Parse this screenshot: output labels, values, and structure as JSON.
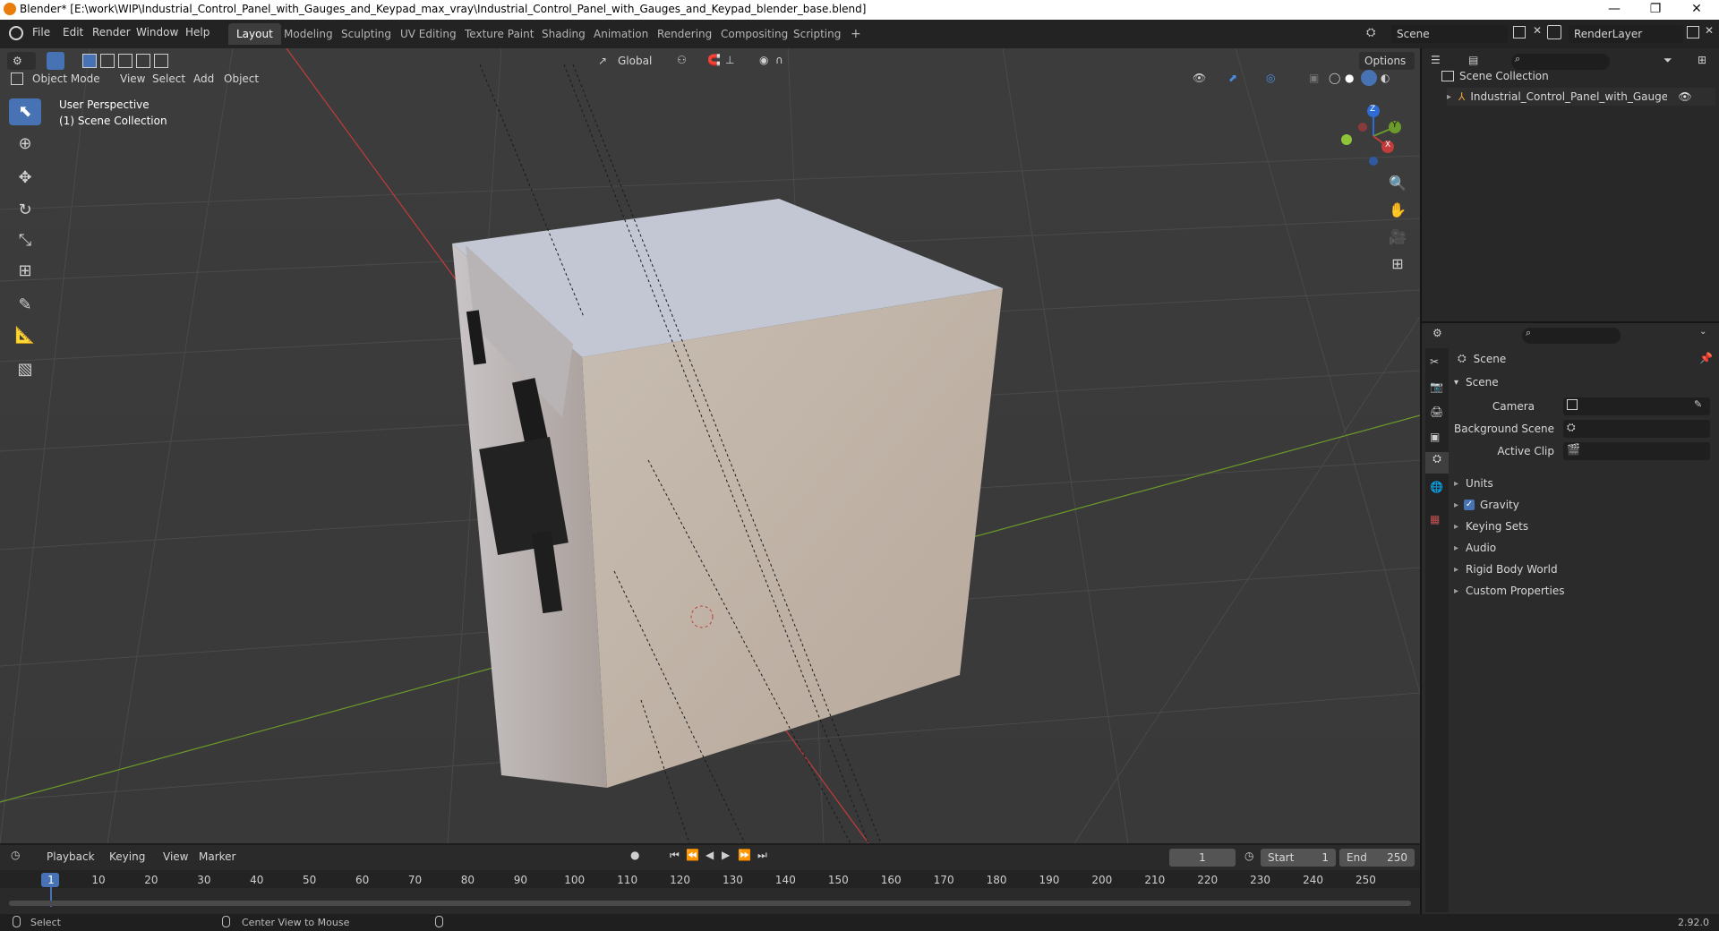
{
  "window": {
    "title": "Blender* [E:\\work\\WIP\\Industrial_Control_Panel_with_Gauges_and_Keypad_max_vray\\Industrial_Control_Panel_with_Gauges_and_Keypad_blender_base.blend]",
    "minimize": "—",
    "restore": "❐",
    "close": "✕"
  },
  "menubar": {
    "items": [
      "File",
      "Edit",
      "Render",
      "Window",
      "Help"
    ],
    "workspaces": [
      "Layout",
      "Modeling",
      "Sculpting",
      "UV Editing",
      "Texture Paint",
      "Shading",
      "Animation",
      "Rendering",
      "Compositing",
      "Scripting"
    ],
    "add_tab": "+",
    "scene": "Scene",
    "render_layer": "RenderLayer"
  },
  "viewport": {
    "mode": "Object Mode",
    "menu": [
      "View",
      "Select",
      "Add",
      "Object"
    ],
    "orientation": "Global",
    "options": "Options",
    "perspective_label": "User Perspective",
    "collection_label": "(1) Scene Collection",
    "gizmo": {
      "z": "Z",
      "y": "Y",
      "x": "X"
    }
  },
  "outliner": {
    "root": "Scene Collection",
    "items": [
      "Industrial_Control_Panel_with_Gauges_and_I"
    ]
  },
  "properties": {
    "context": "Scene",
    "section": "Scene",
    "fields": [
      {
        "label": "Camera"
      },
      {
        "label": "Background Scene"
      },
      {
        "label": "Active Clip"
      }
    ],
    "panels": [
      "Units",
      "Gravity",
      "Keying Sets",
      "Audio",
      "Rigid Body World",
      "Custom Properties"
    ],
    "gravity_checked": true
  },
  "timeline": {
    "menu": [
      "Playback",
      "Keying",
      "View",
      "Marker"
    ],
    "current_frame": "1",
    "start_label": "Start",
    "start": "1",
    "end_label": "End",
    "end": "250",
    "ruler": [
      "1",
      "10",
      "20",
      "30",
      "40",
      "50",
      "60",
      "70",
      "80",
      "90",
      "100",
      "110",
      "120",
      "130",
      "140",
      "150",
      "160",
      "170",
      "180",
      "190",
      "200",
      "210",
      "220",
      "230",
      "240",
      "250"
    ]
  },
  "statusbar": {
    "left": "Select",
    "middle": "Center View to Mouse",
    "version": "2.92.0"
  },
  "colors": {
    "accent": "#4772b3",
    "x_axis": "#c43b3b",
    "y_axis": "#6b9a2a",
    "z_axis": "#2f6bd6"
  }
}
